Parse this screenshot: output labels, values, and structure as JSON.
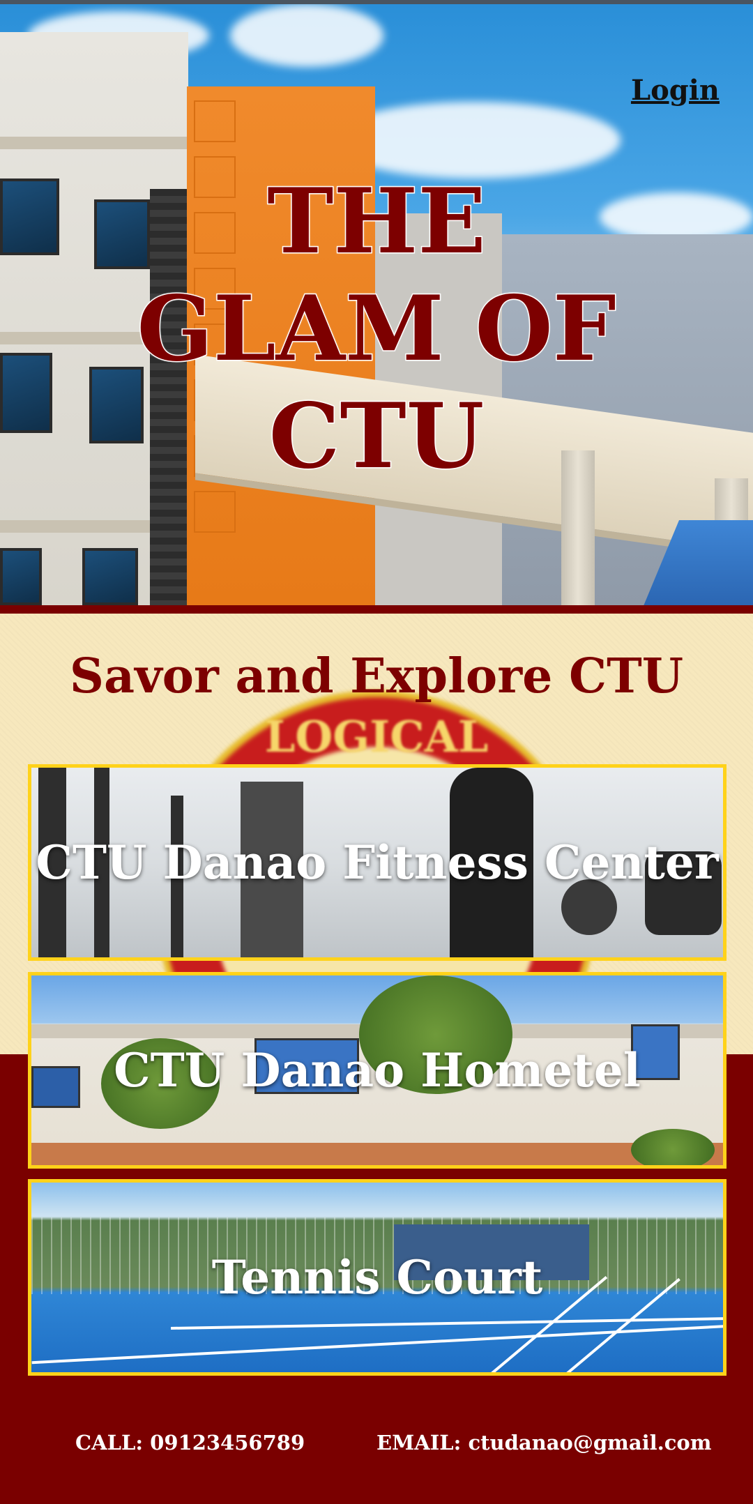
{
  "header": {
    "login_label": "Login"
  },
  "hero": {
    "title_lines": [
      "THE",
      "GLAM OF",
      "CTU"
    ]
  },
  "section": {
    "title": "Savor and Explore CTU",
    "seal_text": "LOGICAL"
  },
  "cards": [
    {
      "label": "CTU Danao Fitness Center"
    },
    {
      "label": "CTU Danao Hometel"
    },
    {
      "label": "Tennis Court"
    }
  ],
  "footer": {
    "call": "CALL: 09123456789",
    "email": "EMAIL: ctudanao@gmail.com"
  },
  "colors": {
    "maroon": "#7a0000",
    "cream": "#f7e8bd",
    "card_border": "#ffd21a",
    "title_red": "#7d0000"
  }
}
